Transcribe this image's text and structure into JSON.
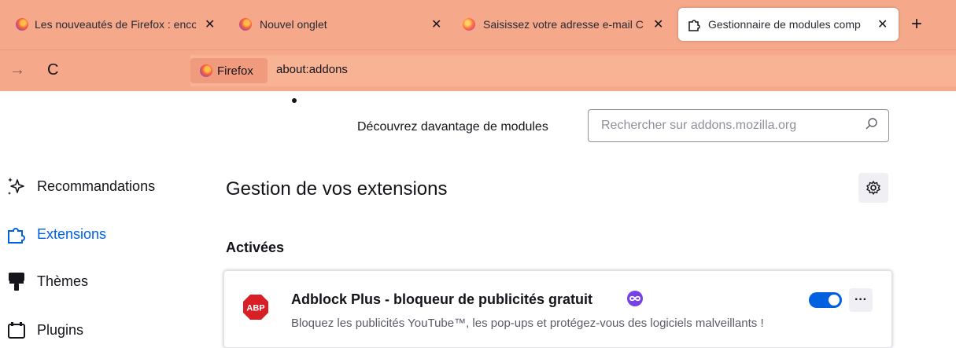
{
  "tabs": [
    {
      "title": "Les nouveautés de Firefox : enco",
      "close": "✕",
      "icon": "firefox-icon"
    },
    {
      "title": "Nouvel onglet",
      "close": "✕",
      "icon": "firefox-icon"
    },
    {
      "title": "Saisissez votre adresse e-mail C",
      "close": "✕",
      "icon": "firefox-account-icon"
    },
    {
      "title": "Gestionnaire de modules comp",
      "close": "✕",
      "icon": "puzzle-icon",
      "active": true
    }
  ],
  "new_tab": "+",
  "nav": {
    "forward": "→",
    "reload": "C"
  },
  "urlbar": {
    "identity": "Firefox",
    "url": "about:addons"
  },
  "discover": {
    "label": "Découvrez davantage de modules",
    "search_placeholder": "Rechercher sur addons.mozilla.org"
  },
  "sidebar": {
    "items": [
      {
        "label": "Recommandations",
        "icon": "sparkle-icon"
      },
      {
        "label": "Extensions",
        "icon": "puzzle-icon",
        "selected": true
      },
      {
        "label": "Thèmes",
        "icon": "brush-icon"
      },
      {
        "label": "Plugins",
        "icon": "plugin-icon"
      }
    ]
  },
  "main": {
    "heading": "Gestion de vos extensions",
    "section": "Activées",
    "addons": [
      {
        "icon_text": "ABP",
        "name": "Adblock Plus - bloqueur de publicités gratuit",
        "description": "Bloquez les publicités YouTube™, les pop-ups et protégez-vous des logiciels malveillants !",
        "enabled": true,
        "more": "···"
      }
    ]
  },
  "colors": {
    "tabstrip": "#f5a88a",
    "accent": "#0061e0",
    "abp_red": "#d81f26",
    "recommended": "#7542e5"
  }
}
